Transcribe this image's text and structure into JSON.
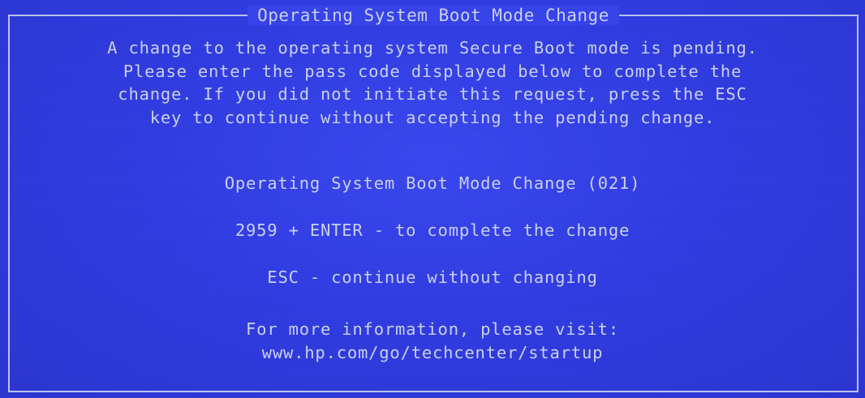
{
  "dialog": {
    "title": "Operating System Boot Mode Change",
    "message_lines": [
      "A change to the operating system Secure Boot mode is pending.",
      "Please enter the pass code displayed below to complete the",
      "change. If you did not initiate this request, press the ESC",
      "key to continue without accepting the pending change."
    ],
    "code_label": "Operating System Boot Mode Change (021)",
    "enter_instruction": "2959 + ENTER - to complete the change",
    "esc_instruction": "ESC - continue without changing",
    "info_line": "For more information, please visit:",
    "info_url": "www.hp.com/go/techcenter/startup"
  },
  "colors": {
    "background": "#2f3be0",
    "text": "#c9cff2",
    "border": "#b9c0ee"
  }
}
